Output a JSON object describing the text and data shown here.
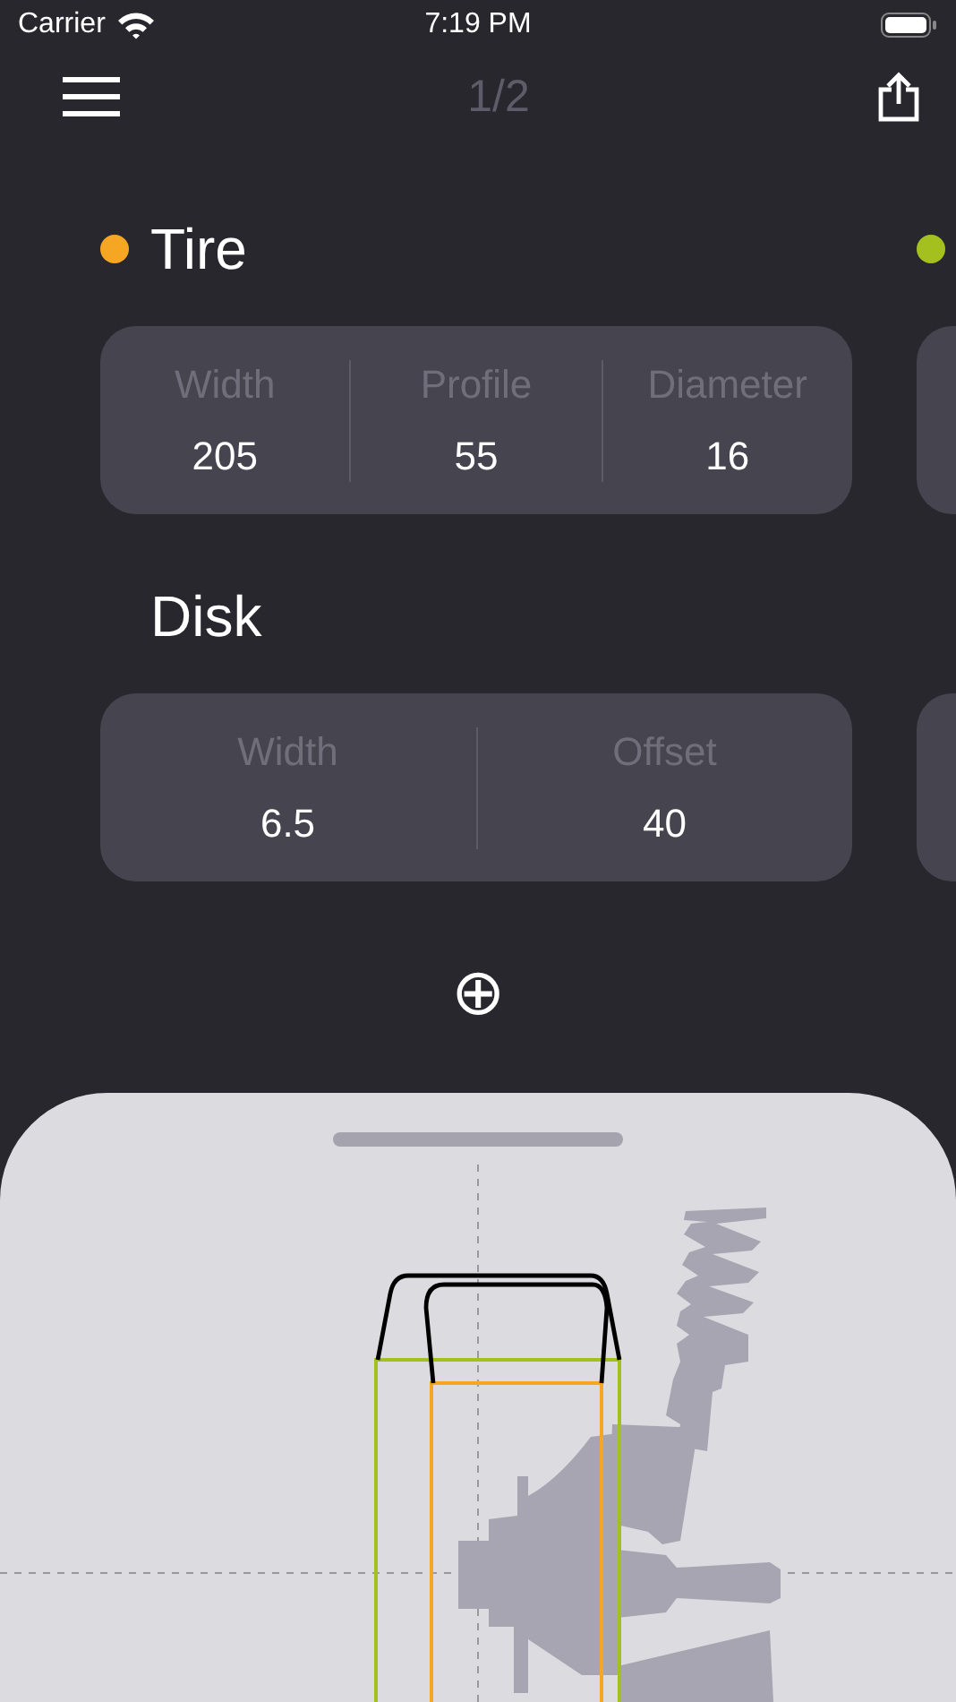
{
  "status_bar": {
    "carrier": "Carrier",
    "time": "7:19 PM"
  },
  "nav": {
    "page_indicator": "1/2"
  },
  "pages": [
    {
      "color": "#f5a623",
      "sections": [
        {
          "title": "Tire",
          "show_dot": true,
          "fields": [
            {
              "label": "Width",
              "value": "205"
            },
            {
              "label": "Profile",
              "value": "55"
            },
            {
              "label": "Diameter",
              "value": "16"
            }
          ]
        },
        {
          "title": "Disk",
          "show_dot": false,
          "fields": [
            {
              "label": "Width",
              "value": "6.5"
            },
            {
              "label": "Offset",
              "value": "40"
            }
          ]
        }
      ]
    },
    {
      "color": "#a4c01e"
    }
  ],
  "add_button": {
    "label": "⊕"
  },
  "diagram": {
    "kind": "wheel-fitment"
  }
}
